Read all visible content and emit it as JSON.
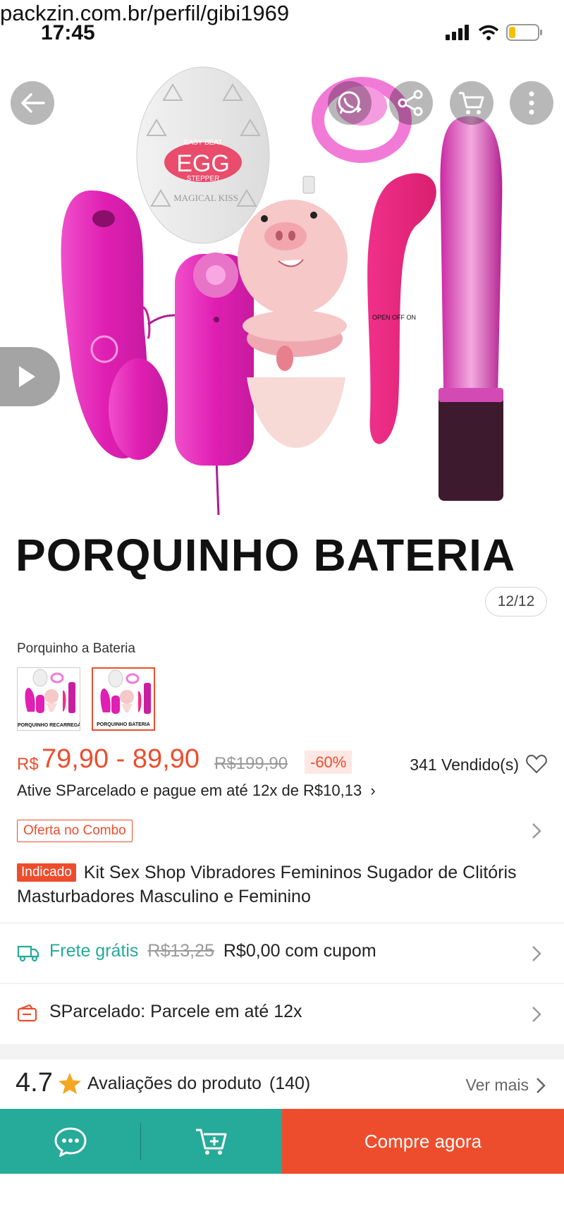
{
  "browser": {
    "url_text": "packzin.com.br/perfil/gibi1969"
  },
  "status_bar": {
    "time": "17:45"
  },
  "hero": {
    "caption": "PORQUINHO BATERIA",
    "image_counter": "12/12",
    "egg_brand": "EGG",
    "egg_top": "EASY BEAT",
    "egg_sub": "STEPPER",
    "egg_maker": "MAGICAL KISS",
    "switch_label": "OPEN  OFF  ON",
    "icons": [
      "back-arrow-icon",
      "whatsapp-share-icon",
      "share-icon",
      "cart-icon",
      "more-icon",
      "play-icon"
    ]
  },
  "variants": {
    "label": "Porquinho a Bateria",
    "options": [
      {
        "caption": "PORQUINHO RECARREGÁVEL",
        "selected": false
      },
      {
        "caption": "PORQUINHO BATERIA",
        "selected": true
      }
    ]
  },
  "price": {
    "currency": "R$",
    "range": "79,90 - 89,90",
    "original": "R$199,90",
    "discount": "-60%",
    "sold": "341 Vendido(s)",
    "installment_text": "Ative SParcelado e pague em até 12x de R$10,13",
    "installment_chevron": "›"
  },
  "combo": {
    "tag": "Oferta no Combo"
  },
  "product": {
    "badge": "Indicado",
    "title": "Kit Sex Shop Vibradores Femininos Sugador de Clitóris Masturbadores Masculino e Feminino"
  },
  "shipping": {
    "label": "Frete grátis",
    "old_price": "R$13,25",
    "new_price_text": "R$0,00 com cupom"
  },
  "installments": {
    "text": "SParcelado: Parcele em até 12x"
  },
  "ratings": {
    "score": "4.7",
    "label": "Avaliações do produto",
    "count": "(140)",
    "see_more": "Ver mais"
  },
  "bottom_bar": {
    "buy_label": "Compre agora"
  },
  "colors": {
    "brand_orange": "#ee4d2d",
    "teal": "#26aa99",
    "pink": "#e0218a",
    "magenta": "#d81fb5",
    "pig": "#f6c8c8",
    "star": "#f5a623"
  }
}
